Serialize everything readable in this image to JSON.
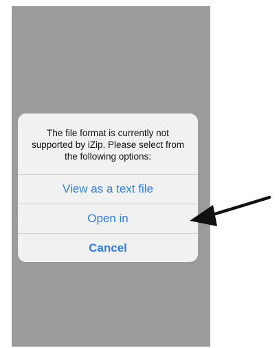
{
  "alert": {
    "message": "The file format is currently not supported by iZip. Please select from the following options:",
    "actions": [
      {
        "label": "View as a text file",
        "style": "default"
      },
      {
        "label": "Open in",
        "style": "default"
      },
      {
        "label": "Cancel",
        "style": "cancel"
      }
    ]
  },
  "colors": {
    "dimmed_background": "#9b9b9b",
    "alert_background": "#f1f1f1",
    "action_text": "#2f7ddd",
    "arrow": "#111111"
  },
  "annotation": {
    "icon": "arrow-left-icon",
    "points_to": "Open in"
  }
}
